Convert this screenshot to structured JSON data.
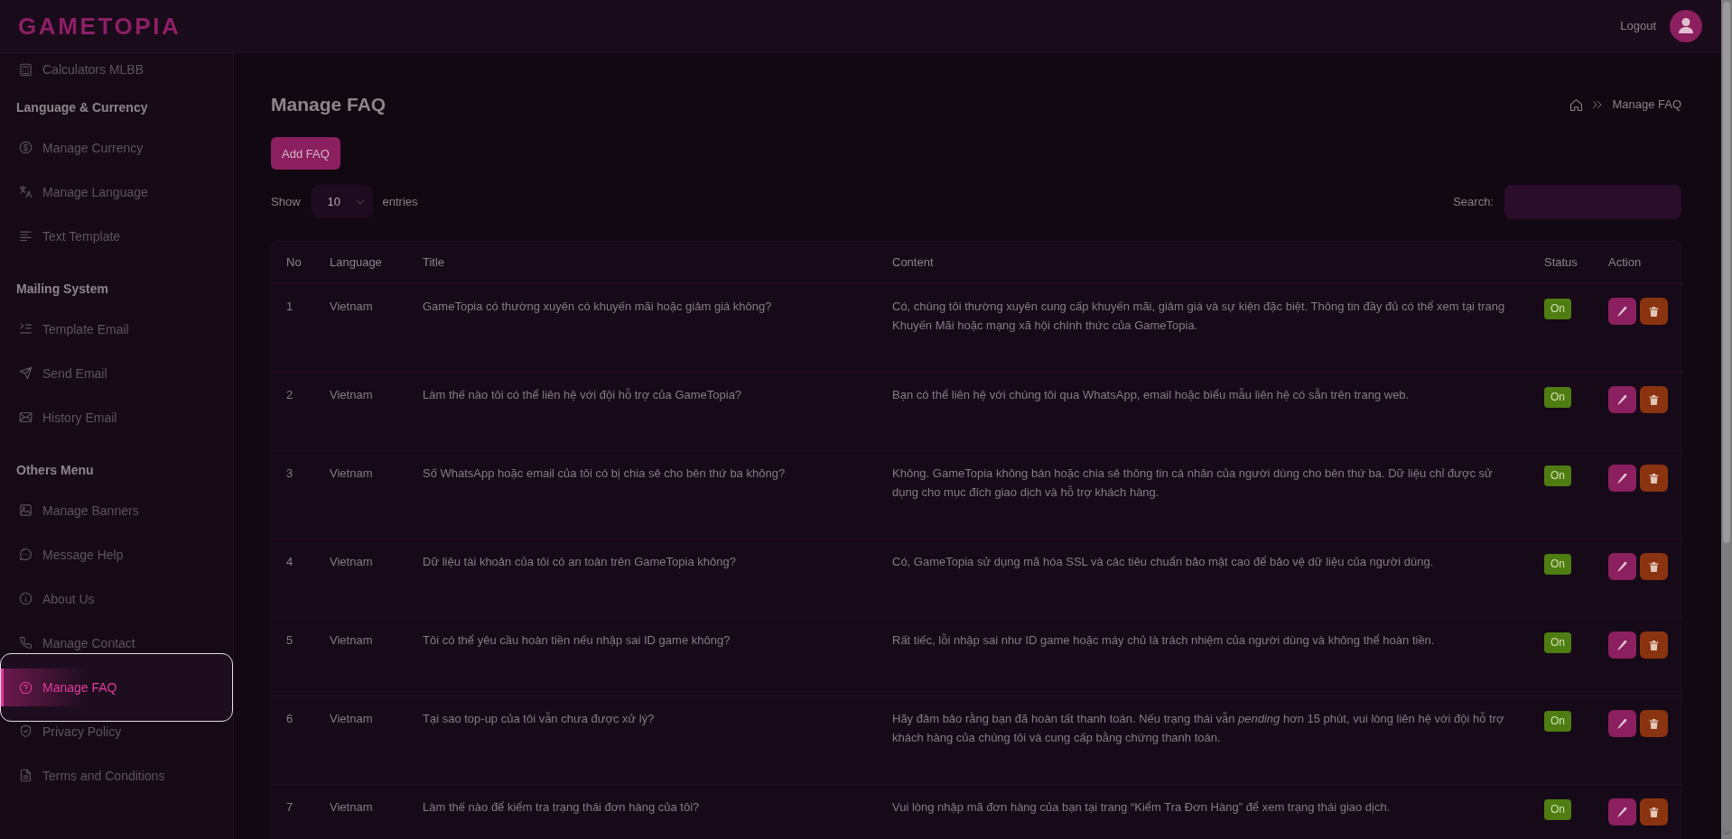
{
  "header": {
    "logo": "GAMETOPIA",
    "logout": "Logout"
  },
  "sidebar": {
    "groups": [
      {
        "items": [
          {
            "label": "Calculators MLBB",
            "selected": false
          }
        ]
      },
      {
        "heading": "Language & Currency",
        "items": [
          {
            "label": "Manage Currency",
            "selected": false
          },
          {
            "label": "Manage Language",
            "selected": false
          },
          {
            "label": "Text Template",
            "selected": false
          }
        ]
      },
      {
        "heading": "Mailing System",
        "items": [
          {
            "label": "Template Email",
            "selected": false
          },
          {
            "label": "Send Email",
            "selected": false
          },
          {
            "label": "History Email",
            "selected": false
          }
        ]
      },
      {
        "heading": "Others Menu",
        "items": [
          {
            "label": "Manage Banners",
            "selected": false
          },
          {
            "label": "Message Help",
            "selected": false
          },
          {
            "label": "About Us",
            "selected": false
          },
          {
            "label": "Manage Contact",
            "selected": false
          },
          {
            "label": "Manage FAQ",
            "selected": true
          },
          {
            "label": "Privacy Policy",
            "selected": false
          },
          {
            "label": "Terms and Conditions",
            "selected": false
          }
        ]
      }
    ]
  },
  "page": {
    "title": "Manage FAQ",
    "breadcrumb": {
      "current": "Manage FAQ"
    }
  },
  "toolbar": {
    "add_button": "Add FAQ",
    "length": {
      "label": "Show",
      "value": "10",
      "suffix": "entries"
    },
    "search": {
      "label": "Search:"
    }
  },
  "table": {
    "columns": [
      "No",
      "Language",
      "Title",
      "Content",
      "Status",
      "Action"
    ],
    "rows": [
      {
        "no": "1",
        "language": "Vietnam",
        "title": "GameTopia có thường xuyên có khuyến mãi hoặc giảm giá không?",
        "content": "Có, chúng tôi thường xuyên cung cấp khuyến mãi, giảm giá và sự kiện đặc biệt. Thông tin đầy đủ có thể xem tại trang Khuyến Mãi hoặc mạng xã hội chính thức của GameTopia.",
        "status": {
          "label": "On",
          "on": true
        }
      },
      {
        "no": "2",
        "language": "Vietnam",
        "title": "Làm thế nào tôi có thể liên hệ với đội hỗ trợ của GameTopia?",
        "content": "Bạn có thể liên hệ với chúng tôi qua WhatsApp, email hoặc biểu mẫu liên hệ có sẵn trên trang web.",
        "status": {
          "label": "On",
          "on": true
        }
      },
      {
        "no": "3",
        "language": "Vietnam",
        "title": "Số WhatsApp hoặc email của tôi có bị chia sẻ cho bên thứ ba không?",
        "content": "Không. GameTopia không bán hoặc chia sẻ thông tin cá nhân của người dùng cho bên thứ ba. Dữ liệu chỉ được sử dụng cho mục đích giao dịch và hỗ trợ khách hàng.",
        "status": {
          "label": "On",
          "on": true
        }
      },
      {
        "no": "4",
        "language": "Vietnam",
        "title": "Dữ liệu tài khoản của tôi có an toàn trên GameTopia không?",
        "content": "Có, GameTopia sử dụng mã hóa SSL và các tiêu chuẩn bảo mật cao để bảo vệ dữ liệu của người dùng.",
        "status": {
          "label": "On",
          "on": true
        }
      },
      {
        "no": "5",
        "language": "Vietnam",
        "title": "Tôi có thể yêu cầu hoàn tiền nếu nhập sai ID game không?",
        "content": "Rất tiếc, lỗi nhập sai như ID game hoặc máy chủ là trách nhiệm của người dùng và không thể hoàn tiền.",
        "status": {
          "label": "On",
          "on": true
        }
      },
      {
        "no": "6",
        "language": "Vietnam",
        "title": "Tại sao top-up của tôi vẫn chưa được xử lý?",
        "content": "Hãy đảm bảo rằng bạn đã hoàn tất thanh toán. Nếu trạng thái vẫn *pending* hơn 15 phút, vui lòng liên hệ với đội hỗ trợ khách hàng của chúng tôi và cung cấp bằng chứng thanh toán.",
        "status": {
          "label": "On",
          "on": true
        }
      },
      {
        "no": "7",
        "language": "Vietnam",
        "title": "Làm thế nào để kiểm tra trạng thái đơn hàng của tôi?",
        "content": "Vui lòng nhập mã đơn hàng của bạn tại trang “Kiểm Tra Đơn Hàng” để xem trạng thái giao dịch.",
        "status": {
          "label": "On",
          "on": true
        }
      }
    ]
  }
}
